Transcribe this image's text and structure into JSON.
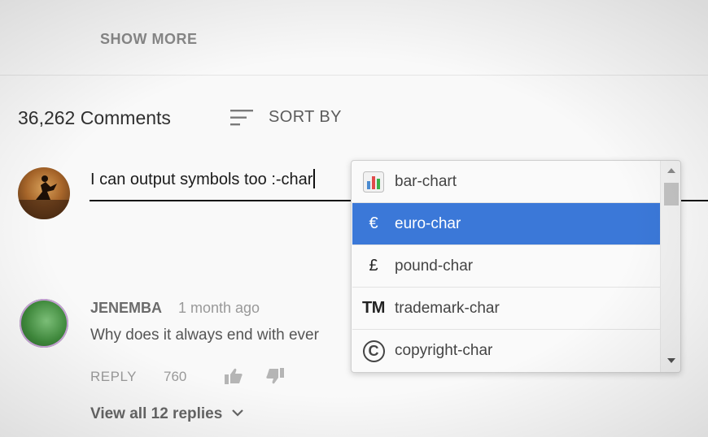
{
  "show_more_label": "SHOW MORE",
  "comments": {
    "count_label": "36,262 Comments",
    "sort_label": "SORT BY"
  },
  "input": {
    "value": "I can output symbols too :-char"
  },
  "autocomplete": {
    "items": [
      {
        "icon": "bar-chart-icon",
        "glyph": "",
        "label": "bar-chart",
        "selected": false
      },
      {
        "icon": "euro-icon",
        "glyph": "€",
        "label": "euro-char",
        "selected": true
      },
      {
        "icon": "pound-icon",
        "glyph": "£",
        "label": "pound-char",
        "selected": false
      },
      {
        "icon": "trademark-icon",
        "glyph": "TM",
        "label": "trademark-char",
        "selected": false
      },
      {
        "icon": "copyright-icon",
        "glyph": "C",
        "label": "copyright-char",
        "selected": false
      }
    ],
    "selected_color": "#3b78d8"
  },
  "thread": {
    "author": "JENEMBA",
    "time": "1 month ago",
    "text": "Why does it always end with ever",
    "reply_label": "REPLY",
    "likes": "760",
    "view_replies": "View all 12 replies"
  }
}
